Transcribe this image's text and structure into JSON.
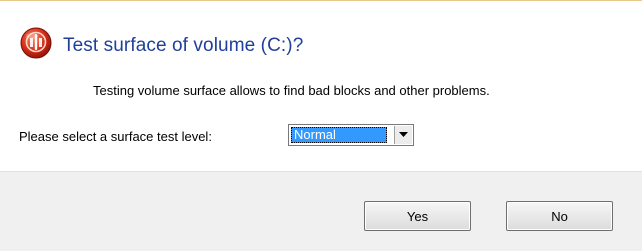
{
  "dialog": {
    "title": "Test surface of volume (C:)?",
    "message": "Testing volume surface allows to find bad blocks and other problems.",
    "icon": "disk-check-icon",
    "accent_title_color": "#1f3f9a"
  },
  "surface_test": {
    "label": "Please select a surface test level:",
    "selected": "Normal"
  },
  "buttons": {
    "yes_label": "Yes",
    "no_label": "No"
  }
}
